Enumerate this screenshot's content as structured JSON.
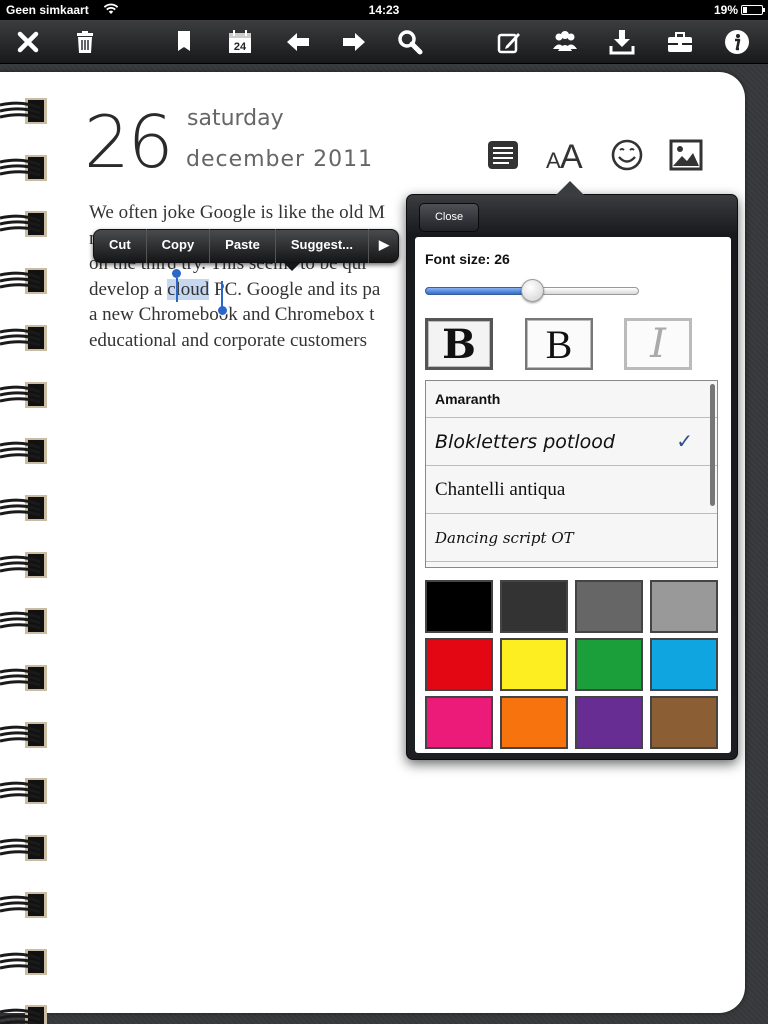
{
  "status": {
    "carrier": "Geen simkaart",
    "time": "14:23",
    "battery": "19%"
  },
  "toolbar": {
    "buttons": [
      "close-icon",
      "trash-icon",
      "bookmark-icon",
      "calendar-icon",
      "arrow-left-icon",
      "arrow-right-icon",
      "search-icon",
      "compose-icon",
      "people-icon",
      "download-icon",
      "toolbox-icon",
      "info-icon"
    ],
    "calendar_day": "24"
  },
  "date": {
    "day": "26",
    "weekday": "saturday",
    "month_year": "december  2011"
  },
  "body": {
    "lines": [
      "We often joke Google is like the old M",
      "n",
      "on the third try. This seems to be qui",
      "develop a ",
      "a new Chromebook and Chromebox t",
      "educational and corporate customers"
    ],
    "selected": "cloud",
    "after_selected": " PC. Google and its pa"
  },
  "edit_menu": {
    "items": [
      "Cut",
      "Copy",
      "Paste",
      "Suggest..."
    ],
    "more": "▶"
  },
  "popover": {
    "close_label": "Close",
    "font_size_label": "Font size: 26",
    "font_size": 26,
    "slider_fraction": 0.5,
    "style_buttons": [
      {
        "label": "B",
        "name": "bold-serif-button"
      },
      {
        "label": "B",
        "name": "bold-button"
      },
      {
        "label": "I",
        "name": "italic-button"
      }
    ],
    "fonts": [
      {
        "name": "Amaranth",
        "selected": false
      },
      {
        "name": "Blokletters potlood",
        "selected": true
      },
      {
        "name": "Chantelli antiqua",
        "selected": false
      },
      {
        "name": "Dancing script OT",
        "selected": false
      }
    ],
    "check_mark": "✓",
    "colors": [
      "#000000",
      "#333333",
      "#666666",
      "#999999",
      "#e30613",
      "#fcee21",
      "#1a9f3a",
      "#0ea5e0",
      "#ec1b7a",
      "#f7730e",
      "#672d93",
      "#8b5e34"
    ]
  }
}
